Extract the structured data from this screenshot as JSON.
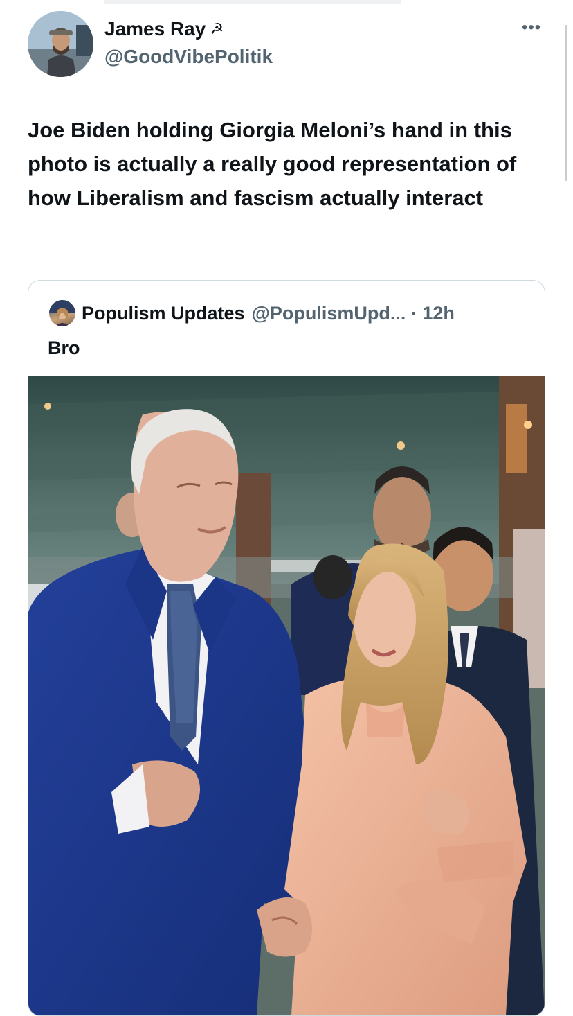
{
  "author": {
    "name": "James Ray",
    "name_emoji": "☭",
    "handle": "@GoodVibePolitik",
    "avatar_icon": "profile-avatar"
  },
  "more_label": "•••",
  "tweet": {
    "text": "Joe Biden holding Giorgia Meloni’s hand in this photo is actually a really good representation of how Liberalism and fascism actually interact"
  },
  "quoted": {
    "name": "Populism Updates",
    "handle": "@PopulismUpd...",
    "separator": " · ",
    "time": "12h",
    "text": "Bro",
    "media_icon": "photo"
  },
  "colors": {
    "text_primary": "#0f1419",
    "text_secondary": "#536471",
    "border": "#cfd9de"
  }
}
